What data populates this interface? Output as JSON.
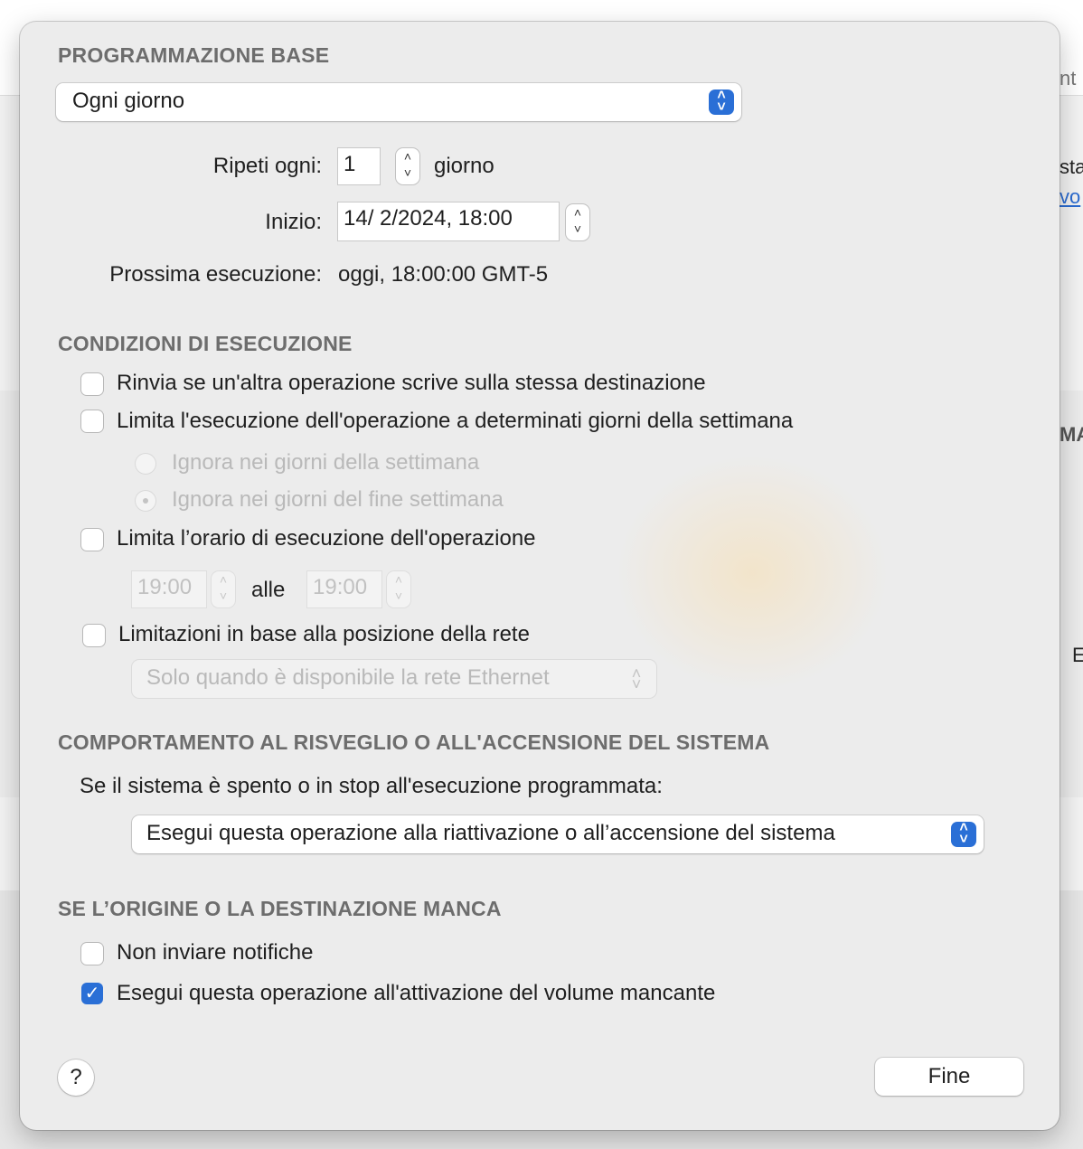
{
  "background": {
    "fragments": [
      "nt",
      "sta",
      "vo",
      "MA",
      "E"
    ]
  },
  "basic": {
    "title": "PROGRAMMAZIONE BASE",
    "frequency_value": "Ogni giorno",
    "repeat_label": "Ripeti ogni:",
    "repeat_value": "1",
    "repeat_unit": "giorno",
    "start_label": "Inizio:",
    "start_value": "14/  2/2024, 18:00",
    "next_label": "Prossima esecuzione:",
    "next_value": "oggi, 18:00:00 GMT-5"
  },
  "conditions": {
    "title": "CONDIZIONI DI ESECUZIONE",
    "defer_label": "Rinvia se un'altra operazione scrive sulla stessa destinazione",
    "defer_checked": false,
    "limit_days_label": "Limita l'esecuzione dell'operazione a determinati giorni della settimana",
    "limit_days_checked": false,
    "radio_weekdays_label": "Ignora nei giorni della settimana",
    "radio_weekend_label": "Ignora nei giorni del fine settimana",
    "radio_selected": "weekend",
    "limit_time_label": "Limita l’orario di esecuzione dell'operazione",
    "limit_time_checked": false,
    "time_from": "19:00",
    "time_sep": "alle",
    "time_to": "19:00",
    "network_label": "Limitazioni in base alla posizione della rete",
    "network_checked": false,
    "network_option": "Solo quando è disponibile la rete Ethernet"
  },
  "wake": {
    "title": "COMPORTAMENTO AL RISVEGLIO O ALL'ACCENSIONE DEL SISTEMA",
    "prompt": "Se il sistema è spento o in stop all'esecuzione programmata:",
    "option": "Esegui questa operazione alla riattivazione o all’accensione del sistema"
  },
  "missing": {
    "title": "SE L’ORIGINE O LA DESTINAZIONE MANCA",
    "no_notify_label": "Non inviare notifiche",
    "no_notify_checked": false,
    "run_on_mount_label": "Esegui questa operazione all'attivazione del volume mancante",
    "run_on_mount_checked": true
  },
  "footer": {
    "help": "?",
    "done": "Fine"
  },
  "colors": {
    "accent": "#2a6fd6",
    "section_title": "#6d6d6d",
    "disabled_text": "#b9b9b9"
  }
}
